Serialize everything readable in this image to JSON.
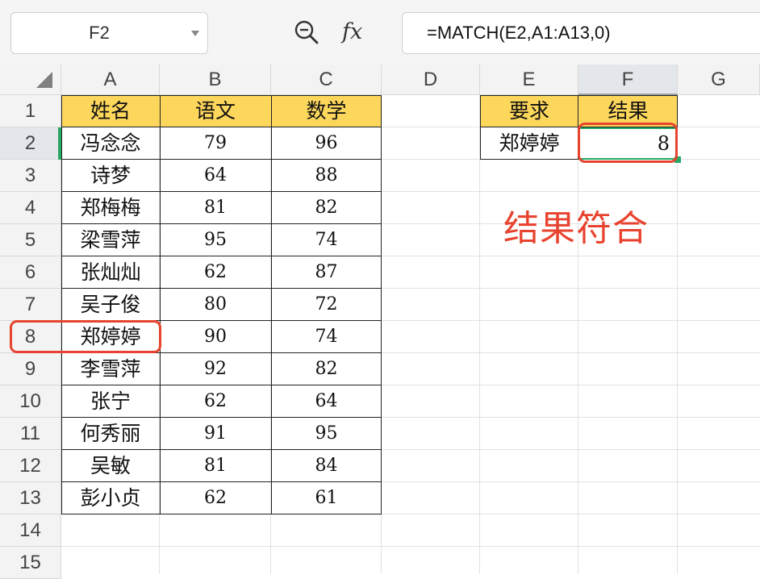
{
  "formula_bar": {
    "name_box": "F2",
    "fx_label": "fx",
    "formula": "=MATCH(E2,A1:A13,0)"
  },
  "columns": [
    "A",
    "B",
    "C",
    "D",
    "E",
    "F",
    "G"
  ],
  "rows": [
    "1",
    "2",
    "3",
    "4",
    "5",
    "6",
    "7",
    "8",
    "9",
    "10",
    "11",
    "12",
    "13",
    "14",
    "15"
  ],
  "table": {
    "headers": [
      "姓名",
      "语文",
      "数学"
    ],
    "rows": [
      [
        "冯念念",
        "79",
        "96"
      ],
      [
        "诗梦",
        "64",
        "88"
      ],
      [
        "郑梅梅",
        "81",
        "82"
      ],
      [
        "梁雪萍",
        "95",
        "74"
      ],
      [
        "张灿灿",
        "62",
        "87"
      ],
      [
        "吴子俊",
        "80",
        "72"
      ],
      [
        "郑婷婷",
        "90",
        "74"
      ],
      [
        "李雪萍",
        "92",
        "82"
      ],
      [
        "张宁",
        "62",
        "64"
      ],
      [
        "何秀丽",
        "91",
        "95"
      ],
      [
        "吴敏",
        "81",
        "84"
      ],
      [
        "彭小贞",
        "62",
        "61"
      ]
    ]
  },
  "lookup": {
    "header_req": "要求",
    "header_res": "结果",
    "value_req": "郑婷婷",
    "value_res": "8"
  },
  "annotation": "结果符合",
  "colors": {
    "header_fill": "#fdd75c",
    "annotation": "#e8432f",
    "selection": "#28a864"
  },
  "icons": [
    "zoom-icon",
    "dropdown-arrow-icon",
    "select-all-icon"
  ]
}
